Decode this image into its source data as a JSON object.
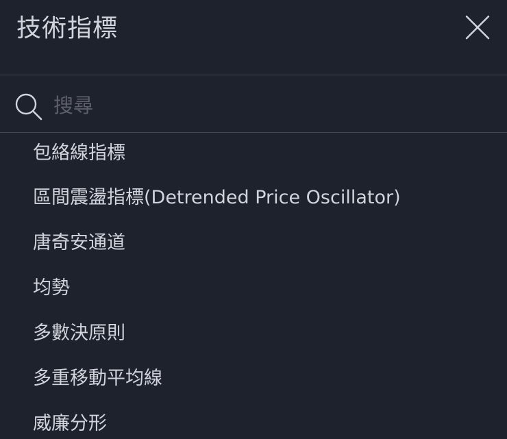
{
  "header": {
    "title": "技術指標",
    "close_icon": "close-icon"
  },
  "search": {
    "icon": "search-icon",
    "placeholder": "搜尋",
    "value": ""
  },
  "indicators": [
    "包絡線指標",
    "區間震盪指標(Detrended Price Oscillator)",
    "唐奇安通道",
    "均勢",
    "多數決原則",
    "多重移動平均線",
    "威廉分形"
  ],
  "colors": {
    "background": "#1e222d",
    "text": "#d1d4dc",
    "placeholder": "#5d606b",
    "divider": "#434651"
  }
}
